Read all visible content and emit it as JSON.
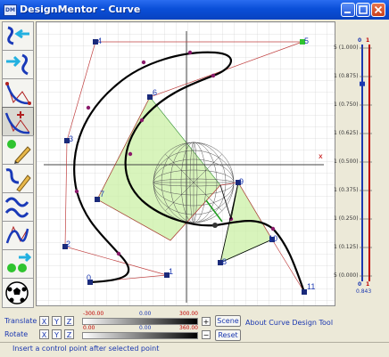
{
  "window": {
    "title": "DesignMentor - Curve",
    "app_icon": "DM"
  },
  "toolbar": {
    "tools": [
      {
        "name": "move-point-tool-icon"
      },
      {
        "name": "translate-curve-tool-icon"
      },
      {
        "name": "control-polygon-tool-icon"
      },
      {
        "name": "insert-point-tool-icon"
      },
      {
        "name": "add-point-pencil-tool-icon"
      },
      {
        "name": "draw-curve-pencil-tool-icon"
      },
      {
        "name": "wave-curve-tool-icon"
      },
      {
        "name": "curve-edit-tool-icon"
      },
      {
        "name": "join-points-tool-icon"
      },
      {
        "name": "soccer-ball-tool-icon"
      }
    ]
  },
  "canvas": {
    "axis_x_label": "x",
    "control_points": [
      {
        "label": "0"
      },
      {
        "label": "1"
      },
      {
        "label": "2"
      },
      {
        "label": "3"
      },
      {
        "label": "4"
      },
      {
        "label": "5"
      },
      {
        "label": "6"
      },
      {
        "label": "7"
      },
      {
        "label": "8"
      },
      {
        "label": "9"
      },
      {
        "label": "10"
      },
      {
        "label": "11"
      }
    ]
  },
  "knot_slider": {
    "top_label_left": "0",
    "top_label_right": "1",
    "bottom_label_left": "0",
    "bottom_label_right": "1",
    "ticks": [
      "5 (1.000)",
      "1 (0.875)",
      "1 (0.750)",
      "1 (0.625)",
      "1 (0.500)",
      "1 (0.375)",
      "1 (0.250)",
      "1 (0.125)",
      "5 (0.000)"
    ],
    "current_value": "0.843",
    "current_fraction": 0.843
  },
  "transform": {
    "translate_label": "Translate",
    "rotate_label": "Rotate",
    "x_button": "X",
    "y_button": "Y",
    "z_button": "Z",
    "translate_min": "-300.00",
    "translate_mid": "0.00",
    "translate_max": "300.00",
    "rotate_min": "0.00",
    "rotate_mid": "0.00",
    "rotate_max": "360.00",
    "plus": "+",
    "minus": "−",
    "scene_button": "Scene",
    "reset_button": "Reset",
    "about_link": "About Curve Design Tool"
  },
  "status": {
    "text": "Insert a control point after selected point"
  }
}
